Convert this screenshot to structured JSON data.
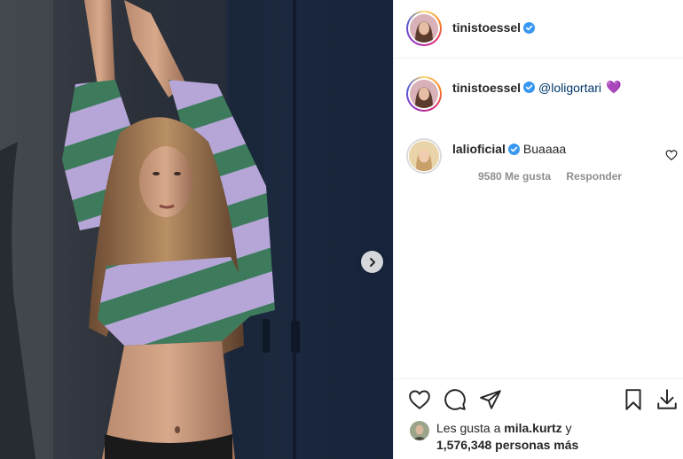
{
  "post": {
    "author": {
      "username": "tinistoessel",
      "verified": true,
      "avatar_icon": "profile-photo"
    },
    "caption": {
      "username": "tinistoessel",
      "verified": true,
      "mention": "@loligortari",
      "emoji": "💜"
    },
    "comments": [
      {
        "username": "lalioficial",
        "verified": true,
        "text": "Buaaaa",
        "likes_label": "9580 Me gusta",
        "reply_label": "Responder"
      }
    ],
    "likes": {
      "prefix": "Les gusta a",
      "user": "mila.kurtz",
      "joiner": "y",
      "count_text": "1,576,348 personas más"
    },
    "icons": {
      "next": "chevron-right-icon",
      "like": "heart-icon",
      "comment": "comment-bubble-icon",
      "share": "paper-plane-icon",
      "save": "bookmark-icon",
      "download": "download-icon",
      "verified": "verified-badge-icon"
    },
    "colors": {
      "verified": "#3897f0",
      "mention": "#00376b",
      "muted": "#8e8e8e",
      "border": "#efefef"
    }
  }
}
